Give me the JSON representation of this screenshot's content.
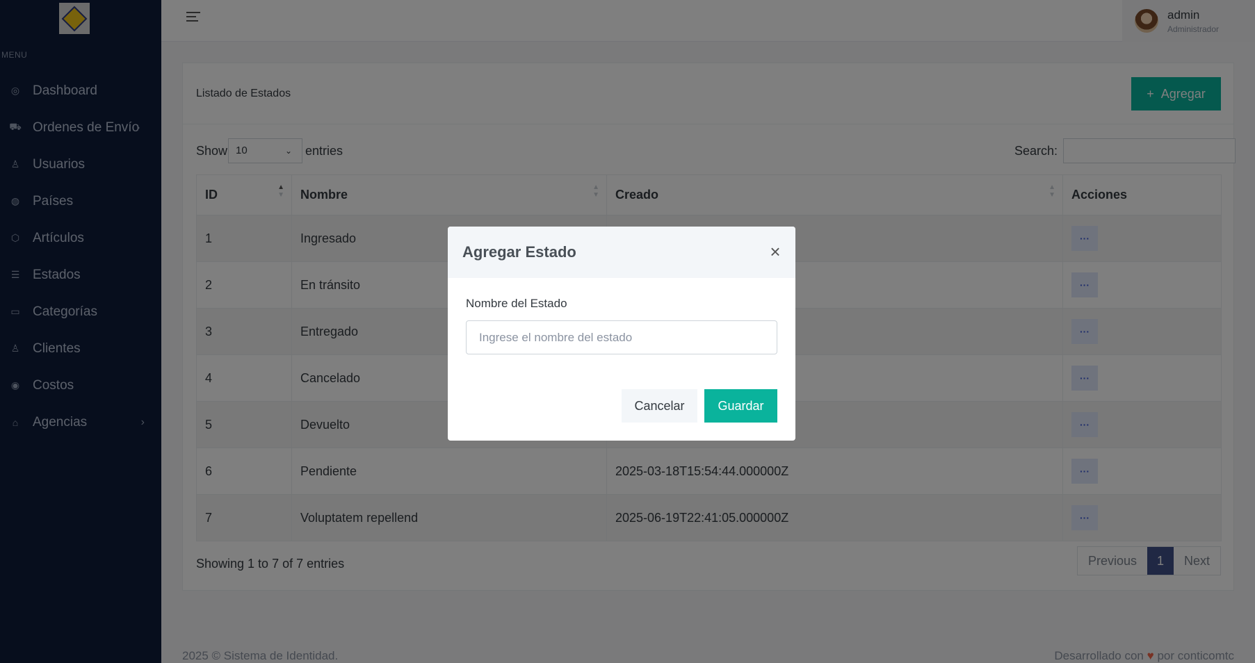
{
  "sidebar": {
    "menu_title": "MENU",
    "items": [
      {
        "label": "Dashboard",
        "icon": "dashboard-icon"
      },
      {
        "label": "Ordenes de Envío",
        "icon": "truck-icon",
        "has_submenu": true
      },
      {
        "label": "Usuarios",
        "icon": "user-icon"
      },
      {
        "label": "Países",
        "icon": "globe-icon"
      },
      {
        "label": "Artículos",
        "icon": "box-icon"
      },
      {
        "label": "Estados",
        "icon": "list-icon"
      },
      {
        "label": "Categorías",
        "icon": "folder-icon"
      },
      {
        "label": "Clientes",
        "icon": "user-check-icon"
      },
      {
        "label": "Costos",
        "icon": "coin-icon"
      },
      {
        "label": "Agencias",
        "icon": "bank-icon",
        "has_submenu": true
      }
    ]
  },
  "topbar": {
    "user_name": "admin",
    "user_role": "Administrador"
  },
  "card": {
    "title": "Listado de Estados",
    "add_label": "Agregar"
  },
  "controls": {
    "show_label": "Show",
    "page_size": "10",
    "entries_label": "entries",
    "search_label": "Search:"
  },
  "table": {
    "columns": [
      "ID",
      "Nombre",
      "Creado",
      "Acciones"
    ],
    "rows": [
      {
        "id": "1",
        "nombre": "Ingresado",
        "creado": ""
      },
      {
        "id": "2",
        "nombre": "En tránsito",
        "creado": ""
      },
      {
        "id": "3",
        "nombre": "Entregado",
        "creado": ""
      },
      {
        "id": "4",
        "nombre": "Cancelado",
        "creado": ""
      },
      {
        "id": "5",
        "nombre": "Devuelto",
        "creado": ""
      },
      {
        "id": "6",
        "nombre": "Pendiente",
        "creado": "2025-03-18T15:54:44.000000Z"
      },
      {
        "id": "7",
        "nombre": "Voluptatem repellend",
        "creado": "2025-06-19T22:41:05.000000Z"
      }
    ],
    "action_label": "···"
  },
  "pagination": {
    "info": "Showing 1 to 7 of 7 entries",
    "previous": "Previous",
    "current": "1",
    "next": "Next"
  },
  "footer": {
    "left": "2025 © Sistema de Identidad.",
    "right_prefix": "Desarrollado con",
    "right_suffix": "por conticomtc"
  },
  "modal": {
    "title": "Agregar Estado",
    "field_label": "Nombre del Estado",
    "field_placeholder": "Ingrese el nombre del estado",
    "field_value": "",
    "cancel_label": "Cancelar",
    "save_label": "Guardar"
  },
  "colors": {
    "sidebar_bg": "#0f1d3a",
    "accent": "#0ab39c",
    "primary": "#405189",
    "action_btn_bg": "#dfe7fb"
  }
}
